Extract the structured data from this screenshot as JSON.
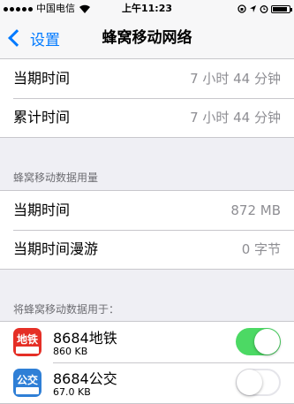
{
  "status_bar": {
    "carrier": "中国电信",
    "time": "上午11:23"
  },
  "nav": {
    "back_label": "设置",
    "title": "蜂窝移动网络"
  },
  "time_rows": [
    {
      "label": "当期时间",
      "value": "7 小时 44 分钟"
    },
    {
      "label": "累计时间",
      "value": "7 小时 44 分钟"
    }
  ],
  "usage_section": {
    "header": "蜂窝移动数据用量",
    "rows": [
      {
        "label": "当期时间",
        "value": "872 MB"
      },
      {
        "label": "当期时间漫游",
        "value": "0 字节"
      }
    ]
  },
  "apps_section": {
    "header": "将蜂窝移动数据用于：",
    "apps": [
      {
        "icon_text": "地铁",
        "icon_name": "metro-app-icon",
        "name": "8684地铁",
        "usage": "860 KB",
        "enabled": true
      },
      {
        "icon_text": "公交",
        "icon_name": "bus-app-icon",
        "name": "8684公交",
        "usage": "67.0 KB",
        "enabled": false
      }
    ]
  },
  "colors": {
    "accent": "#007aff",
    "toggle_on": "#4cd964",
    "background": "#efeff4"
  }
}
